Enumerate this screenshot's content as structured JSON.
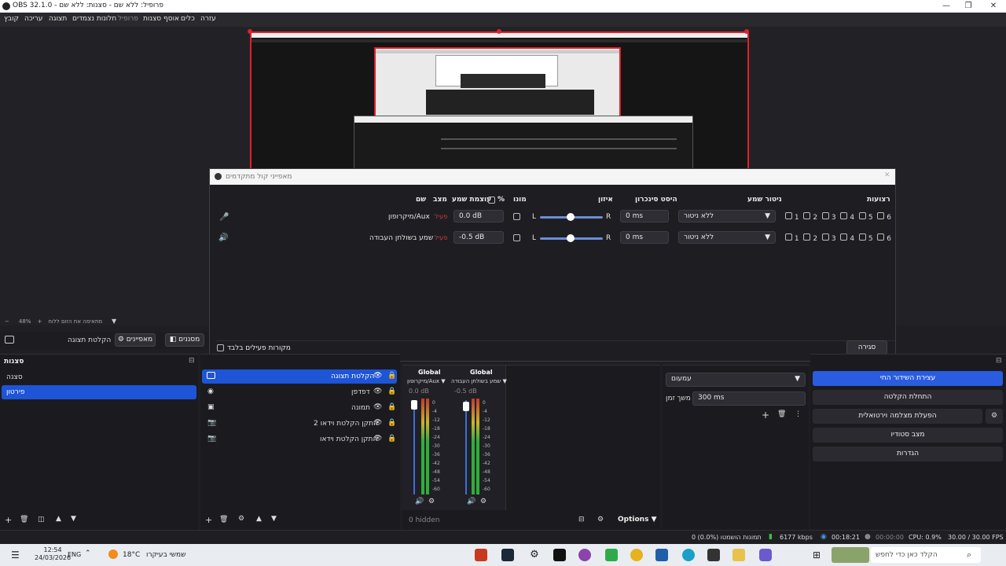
{
  "window": {
    "title": "OBS 32.1.0 - פרופיל: ללא שם - סצנות: ללא שם"
  },
  "menu": [
    "קובץ",
    "עריכה",
    "תצוגה",
    "חלונות נצמדים",
    "פרופיל",
    "אוסף סצנות",
    "כלים",
    "עזרה"
  ],
  "preview": {
    "zoom": "48%",
    "zoom_hint": "מתאימה את הזום ללוח"
  },
  "dialog": {
    "title": "מאפייני קול מתקדמים",
    "headers": {
      "name": "שם",
      "status": "מצב",
      "volume": "עוצמת שמע",
      "percent": "%",
      "mono": "מונו",
      "balance": "איזון",
      "sync": "היסט סינכרון",
      "monitor": "ניטור שמע",
      "tracks": "רצועות"
    },
    "rows": [
      {
        "name": "מיקרופון/Aux",
        "status": "פעיל",
        "volume": "0.0 dB",
        "l": "L",
        "r": "R",
        "sync": "0 ms",
        "monitor": "ללא ניטור",
        "tracks": [
          "1",
          "2",
          "3",
          "4",
          "5",
          "6"
        ]
      },
      {
        "name": "שמע בשולחן העבודה",
        "status": "פעיל",
        "volume": "-0.5 dB",
        "l": "L",
        "r": "R",
        "sync": "0 ms",
        "monitor": "ללא ניטור",
        "tracks": [
          "1",
          "2",
          "3",
          "4",
          "5",
          "6"
        ]
      }
    ],
    "active_only": "מקורות פעילים בלבד",
    "close": "סגירה"
  },
  "toolbar": {
    "properties": "מאפיינים",
    "filters": "מסננים",
    "source_name": "הקלטת תצוגה"
  },
  "scenes": {
    "title": "סצנות",
    "items": [
      "סצנה",
      "פירטון"
    ]
  },
  "sources": {
    "items": [
      "הקלטת תצוגה",
      "דפדפן",
      "תמונה",
      "התקן הקלטת וידאו 2",
      "התקן הקלטת וידאו"
    ]
  },
  "mixer": {
    "channels": [
      {
        "global": "Global",
        "name": "מיקרופון/Aux",
        "db": "0.0 dB"
      },
      {
        "global": "Global",
        "name": "שמע בשולחן העבודה",
        "db": "-0.5 dB"
      }
    ],
    "scale": [
      "0",
      "-4",
      "-12",
      "-18",
      "-24",
      "-30",
      "-36",
      "-42",
      "-48",
      "-54",
      "-60"
    ],
    "hidden": "0 hidden",
    "options": "Options"
  },
  "transitions": {
    "type": "עמעום",
    "duration_label": "משך זמן",
    "duration": "300 ms"
  },
  "controls": [
    "עצירת השידור החי",
    "התחלת הקלטה",
    "הפעלת מצלמה וירטואלית",
    "מצב סטודיו",
    "הגדרות"
  ],
  "status": {
    "dropped": "0 תמונות הושמטו (0.0%)",
    "kbps": "6177 kbps",
    "live_time": "00:18:21",
    "rec_time": "00:00:00",
    "cpu": "CPU: 0.9%",
    "fps": "30.00 / 30.00 FPS"
  },
  "taskbar": {
    "time": "12:54",
    "date": "24/03/2026",
    "lang": "ENG",
    "weather": "18°C",
    "weather_text": "שמשי בעיקרו",
    "search": "הקלד כאן כדי לחפש"
  }
}
